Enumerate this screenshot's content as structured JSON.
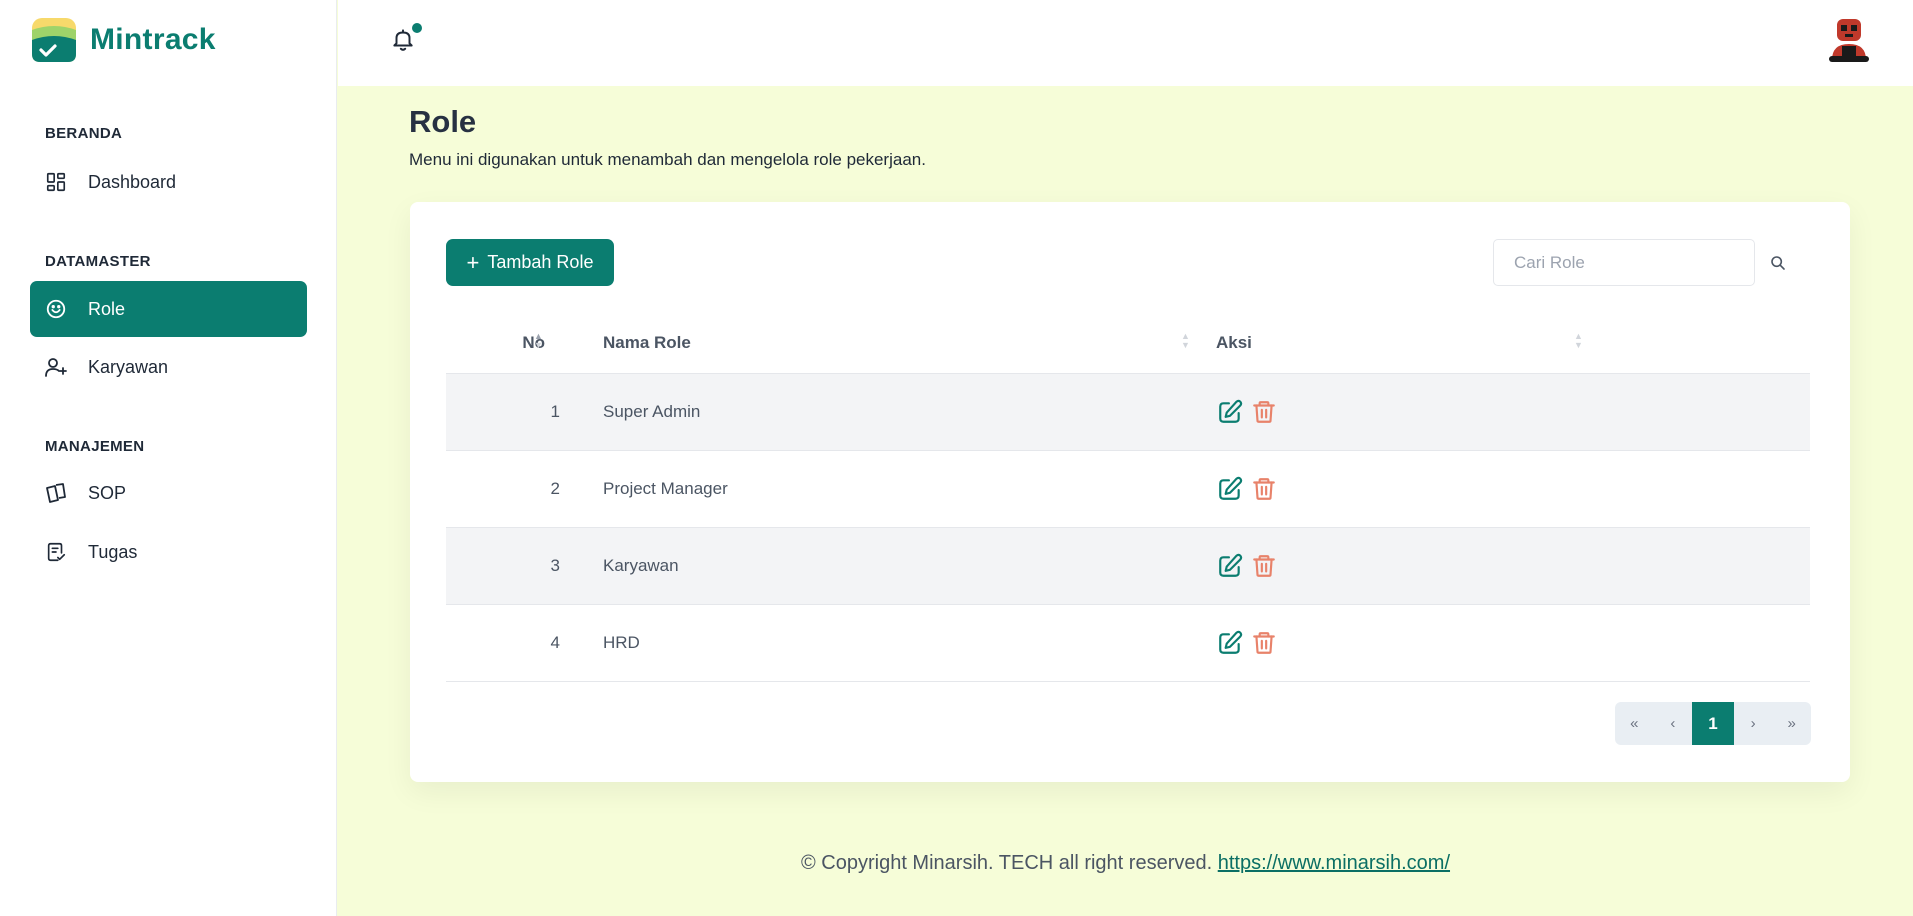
{
  "brand": {
    "name": "Mintrack"
  },
  "sidebar": {
    "sections": [
      {
        "title": "BERANDA"
      },
      {
        "title": "DATAMASTER"
      },
      {
        "title": "MANAJEMEN"
      }
    ],
    "items": [
      {
        "label": "Dashboard",
        "icon": "dashboard-icon"
      },
      {
        "label": "Role",
        "icon": "smiley-icon",
        "active": true
      },
      {
        "label": "Karyawan",
        "icon": "user-plus-icon"
      },
      {
        "label": "SOP",
        "icon": "cards-icon"
      },
      {
        "label": "Tugas",
        "icon": "clipboard-check-icon"
      }
    ]
  },
  "header": {
    "notification_icon": "bell-icon",
    "has_notification": true
  },
  "page": {
    "title": "Role",
    "description": "Menu ini digunakan untuk menambah dan mengelola role pekerjaan."
  },
  "toolbar": {
    "add_label": "Tambah Role",
    "search_placeholder": "Cari Role",
    "search_value": ""
  },
  "table": {
    "columns": [
      "No",
      "Nama Role",
      "Aksi"
    ],
    "rows": [
      {
        "no": "1",
        "name": "Super Admin"
      },
      {
        "no": "2",
        "name": "Project Manager"
      },
      {
        "no": "3",
        "name": "Karyawan"
      },
      {
        "no": "4",
        "name": "HRD"
      }
    ]
  },
  "pagination": {
    "first": "«",
    "prev": "‹",
    "current": "1",
    "next": "›",
    "last": "»"
  },
  "footer": {
    "text": "© Copyright Minarsih. TECH all right reserved.",
    "link_text": "https://www.minarsih.com/"
  },
  "colors": {
    "primary": "#0b7d70",
    "background": "#f6fdd8",
    "delete": "#e8826a",
    "edit": "#0b7d70"
  }
}
